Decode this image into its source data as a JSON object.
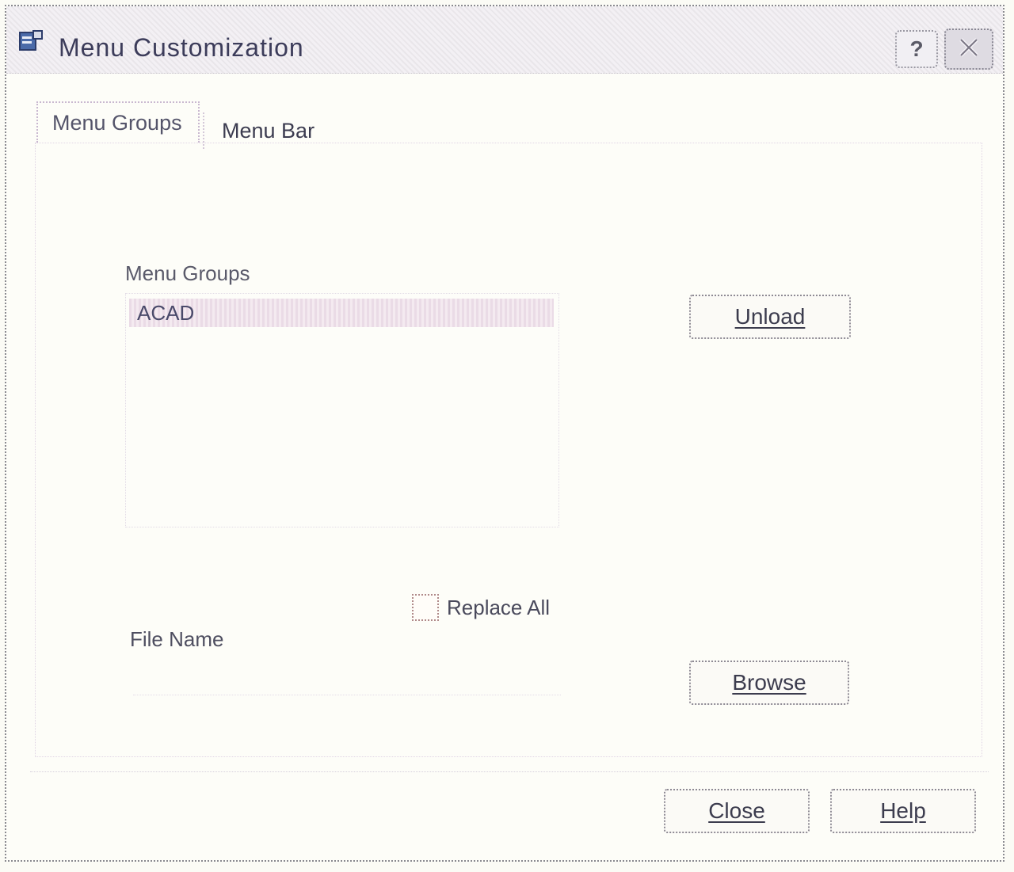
{
  "window": {
    "title": "Menu Customization",
    "help_symbol": "?",
    "close_symbol": "✕"
  },
  "tabs": [
    {
      "label": "Menu Groups",
      "active": true
    },
    {
      "label": "Menu Bar",
      "active": false
    }
  ],
  "menu_groups": {
    "label": "Menu Groups",
    "items": [
      "ACAD"
    ],
    "selected": "ACAD",
    "unload_label": "Unload"
  },
  "replace_all": {
    "label": "Replace All",
    "checked": false
  },
  "file_name": {
    "label": "File Name",
    "value": "",
    "browse_label": "Browse"
  },
  "footer": {
    "close_label": "Close",
    "help_label": "Help"
  },
  "colors": {
    "title_text": "#3c3c5a",
    "selection": "#eadbe6"
  }
}
